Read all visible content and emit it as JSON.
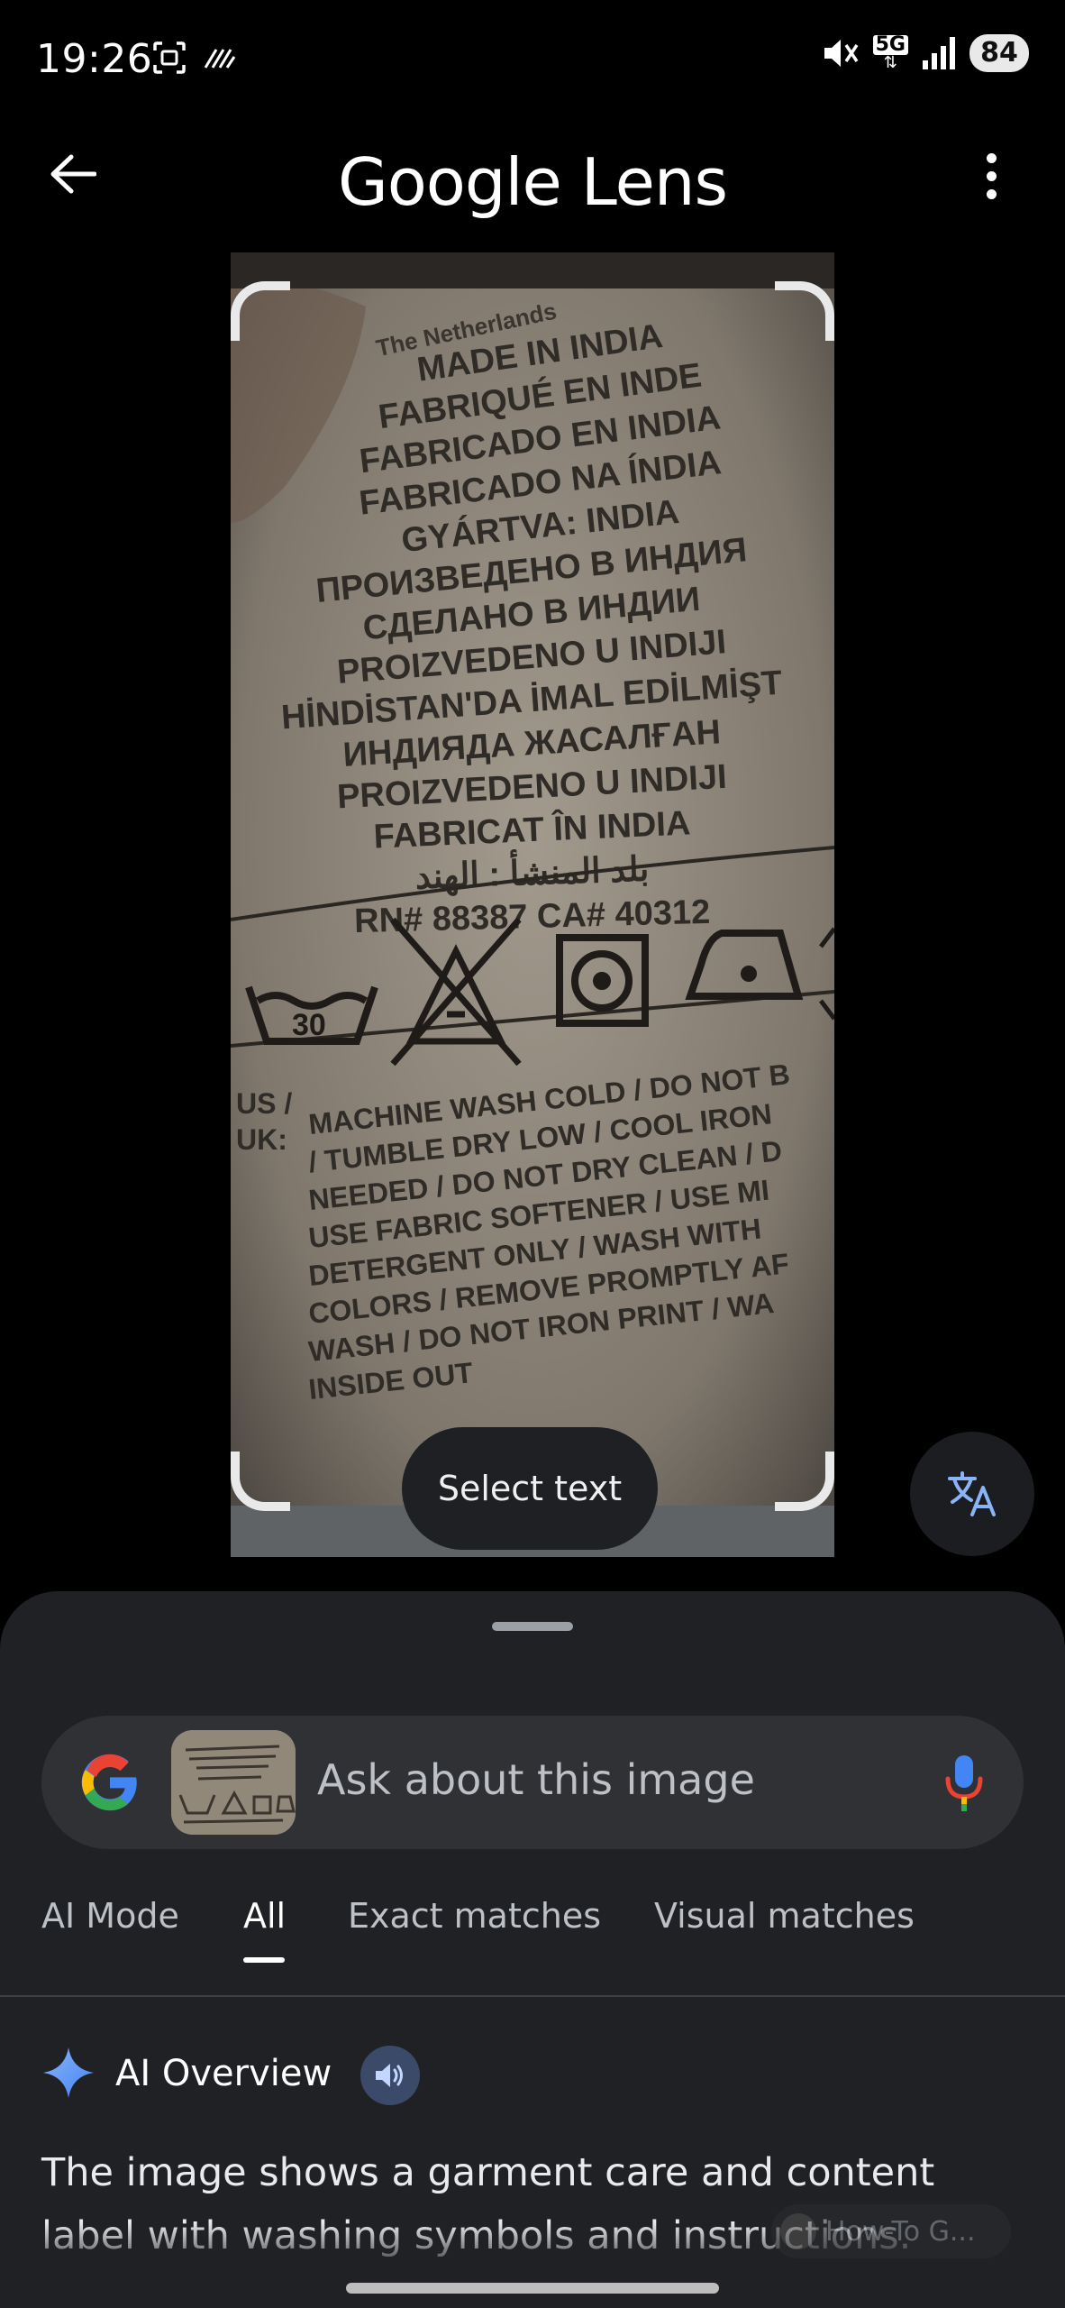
{
  "status_bar": {
    "time": "19:26",
    "network": "5G",
    "battery": "84"
  },
  "header": {
    "title": "Google Lens"
  },
  "image": {
    "label_lines": [
      "MADE IN INDIA",
      "FABRIQUÉ EN INDE",
      "FABRICADO EN INDIA",
      "FABRICADO NA ÍNDIA",
      "GYÁRTVA: INDIA",
      "ПРОИЗВЕДЕНО В ИНДИЯ",
      "СДЕЛАНО В ИНДИИ",
      "PROIZVEDENO U INDIJI",
      "HİNDİSTAN'DA İMAL EDİLMİŞT",
      "ИНДИЯДА ЖАСАЛҒАН",
      "PROIZVEDENO U INDIJI",
      "FABRICAT ÎN INDIA",
      "بلد المنشأ : الهند",
      "RN# 88387 CA# 40312"
    ],
    "wash_temp": "30",
    "care_prefix": [
      "US /",
      "UK:"
    ],
    "care_lines": [
      "MACHINE WASH COLD / DO NOT B",
      "/ TUMBLE DRY LOW / COOL IRON",
      "NEEDED / DO NOT DRY CLEAN / D",
      "USE FABRIC SOFTENER / USE MI",
      "DETERGENT ONLY / WASH WITH",
      "COLORS / REMOVE PROMPTLY AF",
      "WASH / DO NOT IRON PRINT / WA",
      "INSIDE OUT"
    ],
    "top_lines": [
      "The Netherlands"
    ]
  },
  "actions": {
    "select_text": "Select text"
  },
  "search": {
    "placeholder": "Ask about this image"
  },
  "tabs": [
    {
      "label": "AI Mode"
    },
    {
      "label": "All"
    },
    {
      "label": "Exact matches"
    },
    {
      "label": "Visual matches"
    }
  ],
  "ai_overview": {
    "title": "AI Overview",
    "text": "The image shows a garment care and content label with washing symbols and instructions.",
    "source": "How-To G..."
  },
  "colors": {
    "accent_blue": "#4285f4",
    "sheet_bg": "#202124"
  }
}
